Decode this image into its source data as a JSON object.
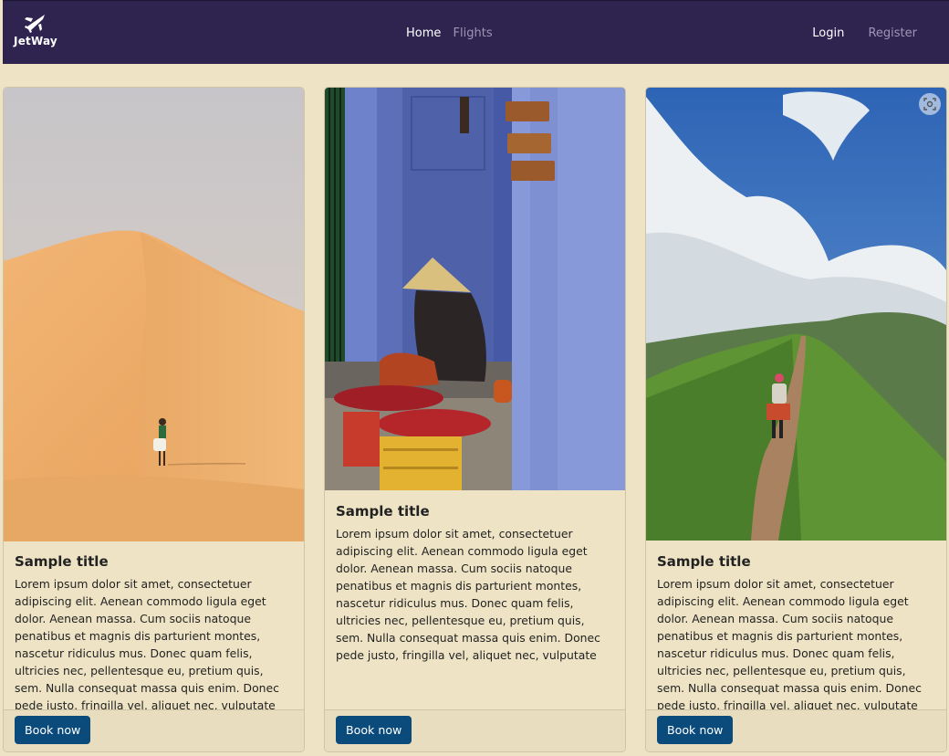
{
  "navbar": {
    "brand": "JetWay",
    "links": [
      {
        "label": "Home",
        "active": true
      },
      {
        "label": "Flights",
        "active": false
      }
    ],
    "auth": [
      {
        "label": "Login",
        "active": true
      },
      {
        "label": "Register",
        "active": false
      }
    ]
  },
  "cards": [
    {
      "title": "Sample title",
      "text": "Lorem ipsum dolor sit amet, consectetuer adipiscing elit. Aenean commodo ligula eget dolor. Aenean massa. Cum sociis natoque penatibus et magnis dis parturient montes, nascetur ridiculus mus. Donec quam felis, ultricies nec, pellentesque eu, pretium quis, sem. Nulla consequat massa quis enim. Donec pede justo, fringilla vel, aliquet nec, vulputate",
      "button": "Book now",
      "image": "desert-dune-photo"
    },
    {
      "title": "Sample title",
      "text": "Lorem ipsum dolor sit amet, consectetuer adipiscing elit. Aenean commodo ligula eget dolor. Aenean massa. Cum sociis natoque penatibus et magnis dis parturient montes, nascetur ridiculus mus. Donec quam felis, ultricies nec, pellentesque eu, pretium quis, sem. Nulla consequat massa quis enim. Donec pede justo, fringilla vel, aliquet nec, vulputate",
      "button": "Book now",
      "image": "street-vendor-photo"
    },
    {
      "title": "Sample title",
      "text": "Lorem ipsum dolor sit amet, consectetuer adipiscing elit. Aenean commodo ligula eget dolor. Aenean massa. Cum sociis natoque penatibus et magnis dis parturient montes, nascetur ridiculus mus. Donec quam felis, ultricies nec, pellentesque eu, pretium quis, sem. Nulla consequat massa quis enim. Donec pede justo, fringilla vel, aliquet nec, vulputate",
      "button": "Book now",
      "image": "mountain-trail-photo"
    }
  ],
  "colors": {
    "navbar": "#2F2450",
    "page": "#EEE4C5",
    "button": "#0B4B7C"
  }
}
